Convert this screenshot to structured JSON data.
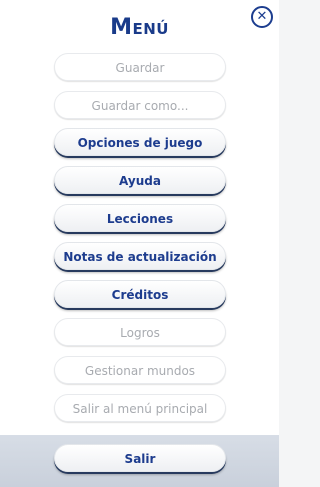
{
  "menu": {
    "title": "Menú",
    "close_glyph": "✕",
    "close_icon": "close-icon",
    "items": [
      {
        "label": "Guardar",
        "enabled": false
      },
      {
        "label": "Guardar como...",
        "enabled": false
      },
      {
        "label": "Opciones de juego",
        "enabled": true
      },
      {
        "label": "Ayuda",
        "enabled": true
      },
      {
        "label": "Lecciones",
        "enabled": true
      },
      {
        "label": "Notas de actualización",
        "enabled": true
      },
      {
        "label": "Créditos",
        "enabled": true
      },
      {
        "label": "Logros",
        "enabled": false
      },
      {
        "label": "Gestionar mundos",
        "enabled": false
      },
      {
        "label": "Salir al menú principal",
        "enabled": false
      }
    ],
    "exit_label": "Salir"
  },
  "colors": {
    "accent": "#1d3c8e",
    "disabled_text": "#a8abb0",
    "footer_bg": "#cfd5df"
  }
}
